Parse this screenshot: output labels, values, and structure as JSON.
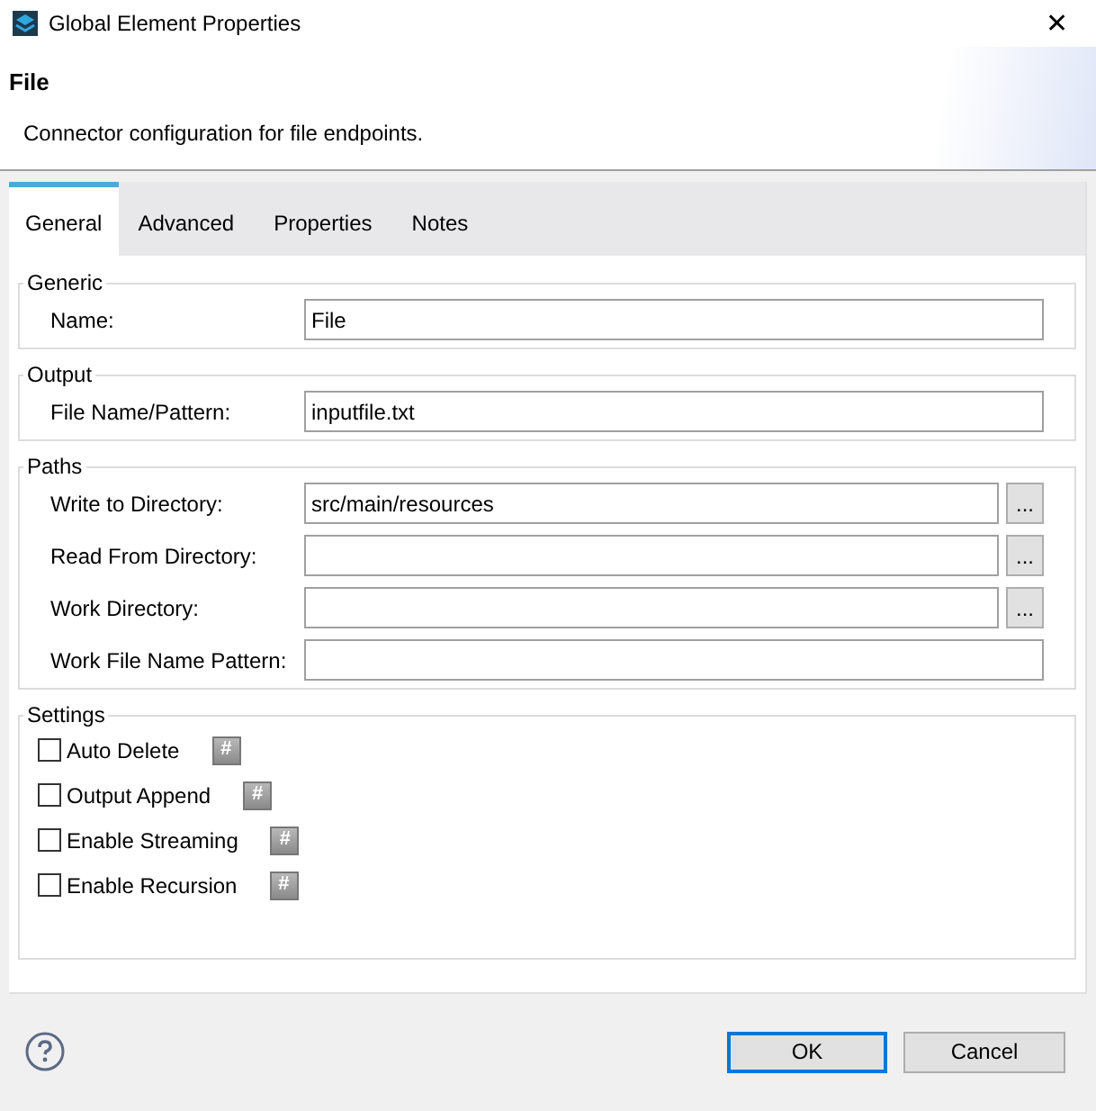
{
  "window": {
    "title": "Global Element Properties",
    "close": "✕"
  },
  "header": {
    "title": "File",
    "description": "Connector configuration for file endpoints."
  },
  "tabs": [
    {
      "label": "General",
      "selected": true
    },
    {
      "label": "Advanced",
      "selected": false
    },
    {
      "label": "Properties",
      "selected": false
    },
    {
      "label": "Notes",
      "selected": false
    }
  ],
  "groups": [
    {
      "title": "Generic",
      "fields": [
        {
          "label": "Name:",
          "value": "File"
        }
      ]
    },
    {
      "title": "Output",
      "fields": [
        {
          "label": "File Name/Pattern:",
          "value": "inputfile.txt"
        }
      ]
    },
    {
      "title": "Paths",
      "fields": [
        {
          "label": "Write to Directory:",
          "value": "src/main/resources",
          "browse": "..."
        },
        {
          "label": "Read From Directory:",
          "browse": "..."
        },
        {
          "label": "Work Directory:",
          "browse": "..."
        },
        {
          "label": "Work File Name Pattern:"
        }
      ]
    }
  ],
  "settings": {
    "title": "Settings",
    "items": [
      {
        "label": "Auto Delete",
        "checked": false,
        "expr": "#"
      },
      {
        "label": "Output Append",
        "checked": false,
        "expr": "#"
      },
      {
        "label": "Enable Streaming",
        "checked": false,
        "expr": "#"
      },
      {
        "label": "Enable Recursion",
        "checked": false,
        "expr": "#"
      }
    ]
  },
  "buttons": [
    {
      "label": "OK",
      "default": true
    },
    {
      "label": "Cancel",
      "default": false
    }
  ]
}
